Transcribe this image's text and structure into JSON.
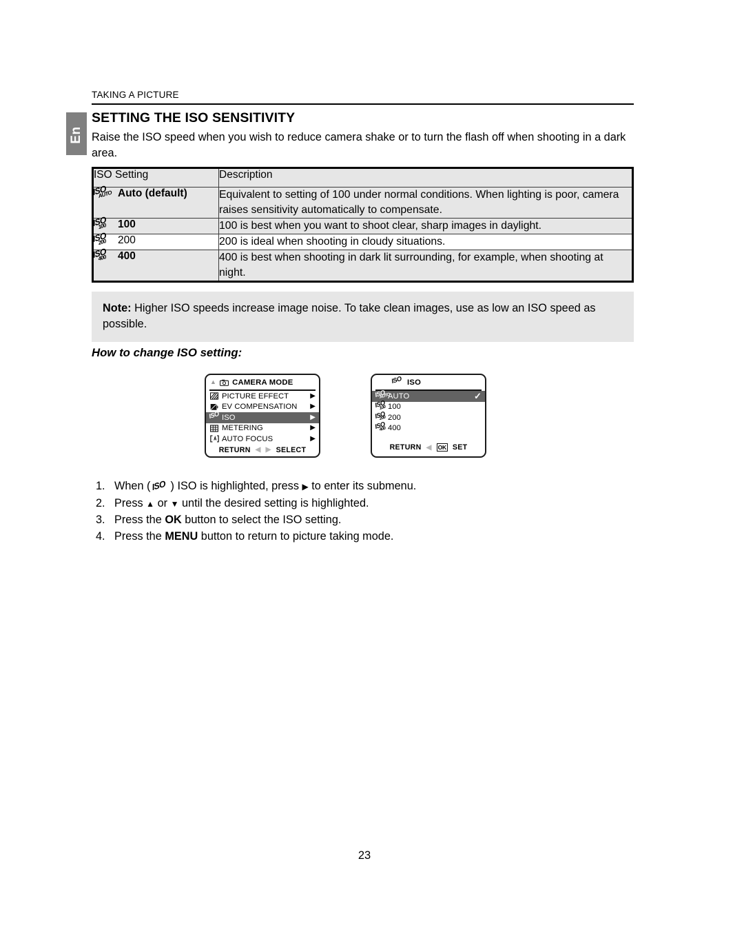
{
  "document": {
    "running_head": "TAKING A PICTURE",
    "language_tab": "En",
    "section_title": "SETTING THE ISO SENSITIVITY",
    "intro": "Raise the ISO speed when you wish to reduce camera shake or to turn the flash off when shooting in a dark area.",
    "page_number": "23"
  },
  "table": {
    "headers": {
      "setting": "ISO Setting",
      "description": "Description"
    },
    "rows": [
      {
        "icon": "iso-auto-icon",
        "icon_main": "ISO",
        "icon_sub": "AUTO",
        "label": "Auto (default)",
        "description": "Equivalent to setting of 100 under normal conditions. When lighting is poor, camera raises sensitivity automatically to compensate."
      },
      {
        "icon": "iso-100-icon",
        "icon_main": "ISO",
        "icon_sub": "100",
        "label": "100",
        "description": "100 is best when you want to shoot clear, sharp images in daylight."
      },
      {
        "icon": "iso-200-icon",
        "icon_main": "ISO",
        "icon_sub": "200",
        "label": "200",
        "description": "200 is ideal when shooting in cloudy situations."
      },
      {
        "icon": "iso-400-icon",
        "icon_main": "ISO",
        "icon_sub": "400",
        "label": "400",
        "description": "400 is best when shooting in dark lit surrounding, for example, when shooting at night."
      }
    ]
  },
  "note": {
    "label": "Note:",
    "text": " Higher ISO speeds increase image noise. To take clean images, use as low an ISO speed as possible."
  },
  "howto": {
    "heading": "How to change ISO setting:"
  },
  "lcd_camera_mode": {
    "title": "CAMERA MODE",
    "title_icon": "camera-icon",
    "scroll_up_icon": "triangle-up-icon",
    "items": [
      {
        "icon": "picture-effect-icon",
        "label": "PICTURE EFFECT",
        "arrow": "▶",
        "selected": false
      },
      {
        "icon": "ev-compensation-icon",
        "label": "EV COMPENSATION",
        "arrow": "▶",
        "selected": false
      },
      {
        "icon": "iso-icon",
        "label": "ISO",
        "arrow": "▶",
        "selected": true
      },
      {
        "icon": "metering-icon",
        "label": "METERING",
        "arrow": "▶",
        "selected": false
      },
      {
        "icon": "auto-focus-icon",
        "label": "AUTO FOCUS",
        "arrow": "▶",
        "selected": false
      }
    ],
    "footer": {
      "return": "RETURN",
      "left_arrow": "◀",
      "right_arrow": "▶",
      "select": "SELECT"
    }
  },
  "lcd_iso_submenu": {
    "title": "ISO",
    "title_icon": "iso-icon",
    "items": [
      {
        "icon": "iso-auto-icon",
        "icon_sub": "AUTO",
        "label": "AUTO",
        "selected": true,
        "checked": "✓"
      },
      {
        "icon": "iso-100-icon",
        "icon_sub": "100",
        "label": "100",
        "selected": false,
        "checked": ""
      },
      {
        "icon": "iso-200-icon",
        "icon_sub": "200",
        "label": "200",
        "selected": false,
        "checked": ""
      },
      {
        "icon": "iso-400-icon",
        "icon_sub": "400",
        "label": "400",
        "selected": false,
        "checked": ""
      }
    ],
    "footer": {
      "return": "RETURN",
      "left_arrow": "◀",
      "ok": "OK",
      "set": "SET"
    }
  },
  "steps": [
    {
      "num": "1.",
      "pre": "When (",
      "glyph": "iso-icon",
      "post": ") ISO is highlighted, press ",
      "arrow": "▶",
      "tail": " to enter its submenu."
    },
    {
      "num": "2.",
      "pre": "Press ",
      "up": "▲",
      "mid": " or ",
      "down": "▼",
      "tail": " until the desired setting is highlighted."
    },
    {
      "num": "3.",
      "pre": "Press the ",
      "bold": "OK",
      "tail": " button to select the ISO setting."
    },
    {
      "num": "4.",
      "pre": "Press the ",
      "bold": "MENU",
      "tail": " button to return to picture taking mode."
    }
  ],
  "colors": {
    "row_shade": "#e6e6e6",
    "tab_gray": "#808080",
    "selection_gray": "#636363",
    "rule_black": "#000000"
  }
}
